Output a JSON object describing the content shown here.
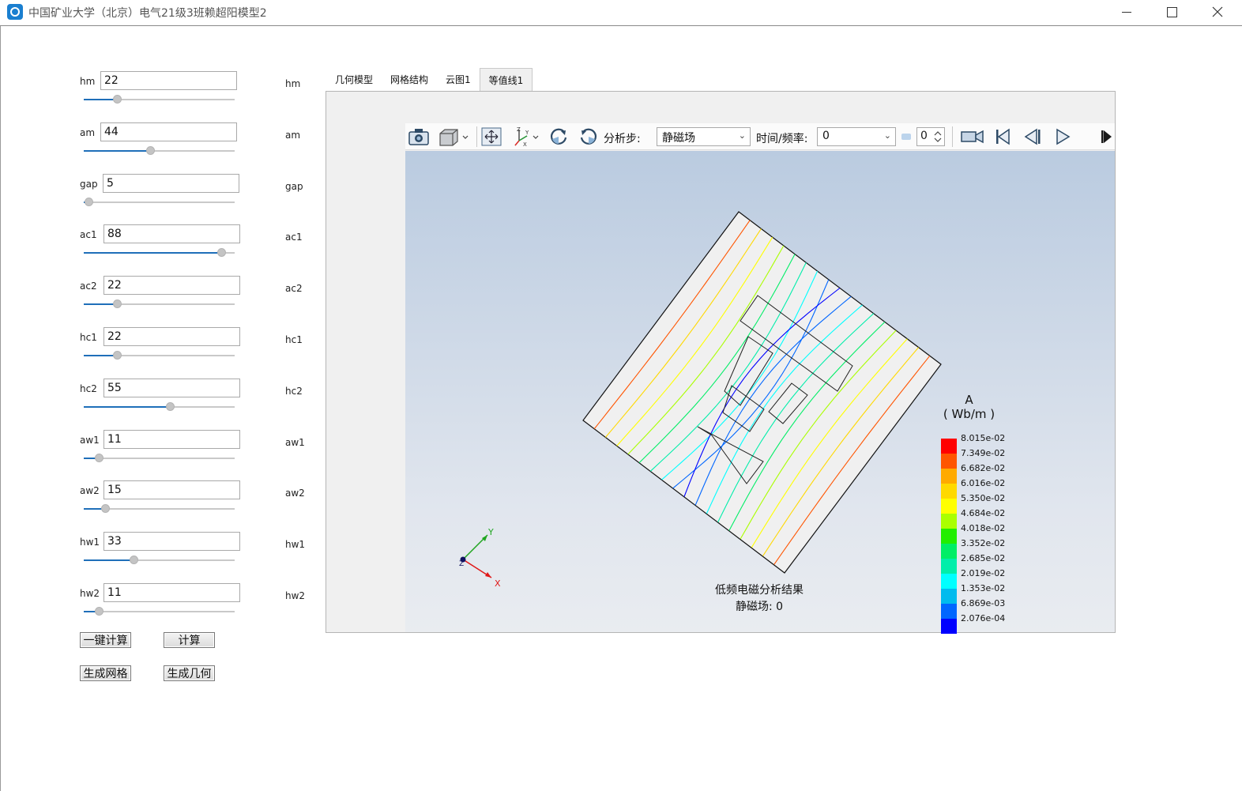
{
  "window": {
    "title": "中国矿业大学（北京）电气21级3班赖超阳模型2",
    "controls": [
      "minimize",
      "maximize",
      "close"
    ]
  },
  "params": [
    {
      "label": "hm",
      "value": "22",
      "echo": "hm",
      "level": 0.22
    },
    {
      "label": "am",
      "value": "44",
      "echo": "am",
      "level": 0.44
    },
    {
      "label": "gap",
      "value": "5",
      "echo": "gap",
      "level": 0.03
    },
    {
      "label": "ac1",
      "value": "88",
      "echo": "ac1",
      "level": 0.91
    },
    {
      "label": "ac2",
      "value": "22",
      "echo": "ac2",
      "level": 0.22
    },
    {
      "label": "hc1",
      "value": "22",
      "echo": "hc1",
      "level": 0.22
    },
    {
      "label": "hc2",
      "value": "55",
      "echo": "hc2",
      "level": 0.57
    },
    {
      "label": "aw1",
      "value": "11",
      "echo": "aw1",
      "level": 0.1
    },
    {
      "label": "aw2",
      "value": "15",
      "echo": "aw2",
      "level": 0.14
    },
    {
      "label": "hw1",
      "value": "33",
      "echo": "hw1",
      "level": 0.33
    },
    {
      "label": "hw2",
      "value": "11",
      "echo": "hw2",
      "level": 0.1
    }
  ],
  "buttons": {
    "one_click_calc": "一键计算",
    "calc": "计算",
    "gen_mesh": "生成网格",
    "gen_geometry": "生成几何"
  },
  "tabs": [
    {
      "label": "几何模型",
      "active": false
    },
    {
      "label": "网格结构",
      "active": false
    },
    {
      "label": "云图1",
      "active": false
    },
    {
      "label": "等值线1",
      "active": true
    }
  ],
  "toolbar": {
    "analysis_step_label": "分析步:",
    "analysis_step_value": "静磁场",
    "time_freq_label": "时间/频率:",
    "time_freq_value": "0",
    "frame_value": "0"
  },
  "viewer": {
    "caption_line1": "低频电磁分析结果",
    "caption_line2": "静磁场: 0",
    "axes": {
      "x": "X",
      "y": "Y",
      "z": "Z"
    }
  },
  "legend": {
    "quantity": "A",
    "unit": "( Wb/m )",
    "entries": [
      {
        "value": "8.015e-02",
        "color": "#ff0000"
      },
      {
        "value": "7.349e-02",
        "color": "#ff5500"
      },
      {
        "value": "6.682e-02",
        "color": "#ffaa00"
      },
      {
        "value": "6.016e-02",
        "color": "#ffd900"
      },
      {
        "value": "5.350e-02",
        "color": "#ffff00"
      },
      {
        "value": "4.684e-02",
        "color": "#aaff00"
      },
      {
        "value": "4.018e-02",
        "color": "#22ee00"
      },
      {
        "value": "3.352e-02",
        "color": "#00ee66"
      },
      {
        "value": "2.685e-02",
        "color": "#00eeaa"
      },
      {
        "value": "2.019e-02",
        "color": "#00ffff"
      },
      {
        "value": "1.353e-02",
        "color": "#00bbee"
      },
      {
        "value": "6.869e-03",
        "color": "#0066ff"
      },
      {
        "value": "2.076e-04",
        "color": "#0000ff"
      }
    ]
  }
}
